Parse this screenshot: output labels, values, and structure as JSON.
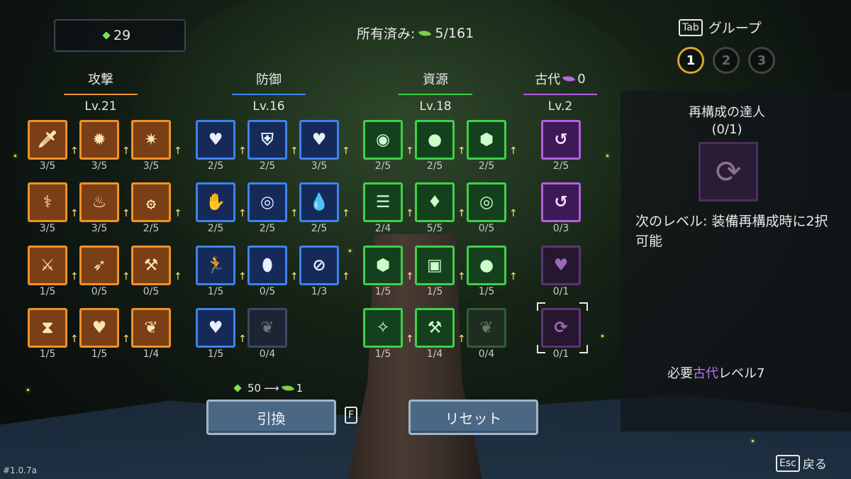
{
  "currency": {
    "amount": "29"
  },
  "owned": {
    "label": "所有済み:",
    "value": "5/161"
  },
  "groups": {
    "key": "Tab",
    "label": "グループ",
    "items": [
      "1",
      "2",
      "3"
    ],
    "active": 0
  },
  "columns": [
    {
      "title": "攻撃",
      "level": "Lv.21",
      "color": "#f0922a"
    },
    {
      "title": "防御",
      "level": "Lv.16",
      "color": "#3f83ec"
    },
    {
      "title": "資源",
      "level": "Lv.18",
      "color": "#3fd04a"
    },
    {
      "title": "古代",
      "badge": "0",
      "level": "Lv.2",
      "color": "#b35fe0"
    }
  ],
  "skills": {
    "attack": [
      {
        "icon": "sword-icon",
        "glyph": "🗡",
        "count": "3/5"
      },
      {
        "icon": "explosion-icon",
        "glyph": "✹",
        "count": "3/5"
      },
      {
        "icon": "burst-icon",
        "glyph": "✷",
        "count": "3/5"
      },
      {
        "icon": "staff-icon",
        "glyph": "⚕",
        "count": "3/5"
      },
      {
        "icon": "flame-icon",
        "glyph": "♨",
        "count": "3/5"
      },
      {
        "icon": "fire-ring-icon",
        "glyph": "۞",
        "count": "2/5"
      },
      {
        "icon": "slash-icon",
        "glyph": "⚔",
        "count": "1/5"
      },
      {
        "icon": "dash-icon",
        "glyph": "➶",
        "count": "0/5"
      },
      {
        "icon": "claw-icon",
        "glyph": "⚒",
        "count": "0/5"
      },
      {
        "icon": "hourglass-icon",
        "glyph": "⧗",
        "count": "1/5"
      },
      {
        "icon": "broken-heart-icon",
        "glyph": "♥",
        "count": "1/5"
      },
      {
        "icon": "leaf-icon",
        "glyph": "❦",
        "count": "1/4"
      }
    ],
    "defense": [
      {
        "icon": "hp-heart-icon",
        "glyph": "♥",
        "count": "2/5"
      },
      {
        "icon": "shield-icon",
        "glyph": "⛨",
        "count": "2/5"
      },
      {
        "icon": "heal-heart-icon",
        "glyph": "♥",
        "count": "3/5"
      },
      {
        "icon": "hand-icon",
        "glyph": "✋",
        "count": "2/5"
      },
      {
        "icon": "target-icon",
        "glyph": "◎",
        "count": "2/5"
      },
      {
        "icon": "droplet-icon",
        "glyph": "💧",
        "count": "2/5"
      },
      {
        "icon": "dodge-icon",
        "glyph": "🏃",
        "count": "1/5"
      },
      {
        "icon": "egg-icon",
        "glyph": "⬮",
        "count": "0/5"
      },
      {
        "icon": "ban-icon",
        "glyph": "⊘",
        "count": "1/3"
      },
      {
        "icon": "heart-10-icon",
        "glyph": "♥",
        "count": "1/5"
      },
      {
        "icon": "leaf-icon",
        "glyph": "❦",
        "count": "0/4"
      }
    ],
    "resource": [
      {
        "icon": "coin-icon",
        "glyph": "◉",
        "count": "2/5"
      },
      {
        "icon": "orb-icon",
        "glyph": "●",
        "count": "2/5"
      },
      {
        "icon": "crystal-icon",
        "glyph": "⬢",
        "count": "2/5"
      },
      {
        "icon": "coin-stack-icon",
        "glyph": "☰",
        "count": "2/4"
      },
      {
        "icon": "drop-icon",
        "glyph": "♦",
        "count": "5/5"
      },
      {
        "icon": "coin-10-icon",
        "glyph": "◎",
        "count": "0/5"
      },
      {
        "icon": "crystal-10-icon",
        "glyph": "⬢",
        "count": "1/5"
      },
      {
        "icon": "chest-icon",
        "glyph": "▣",
        "count": "1/5"
      },
      {
        "icon": "slime-icon",
        "glyph": "●",
        "count": "1/5"
      },
      {
        "icon": "fairy-icon",
        "glyph": "✧",
        "count": "1/5"
      },
      {
        "icon": "anvil-icon",
        "glyph": "⚒",
        "count": "1/4"
      },
      {
        "icon": "leaf-icon",
        "glyph": "❦",
        "count": "0/4"
      }
    ],
    "ancient": [
      {
        "icon": "swirl-icon",
        "glyph": "↺",
        "count": "2/5"
      },
      {
        "icon": "sparkle-swirl-icon",
        "glyph": "↺",
        "count": "0/3"
      },
      {
        "icon": "winged-heart-icon",
        "glyph": "♥",
        "count": "0/1"
      },
      {
        "icon": "hammer-cycle-icon",
        "glyph": "⟳",
        "count": "0/1"
      }
    ]
  },
  "detail": {
    "title": "再構成の達人",
    "progress": "(0/1)",
    "icon": "hammer-cycle-icon",
    "glyph": "⟳",
    "description": "次のレベル: 装備再構成時に2択可能",
    "requirement_prefix": "必要",
    "requirement_accent": "古代",
    "requirement_suffix": "レベル7"
  },
  "exchange": {
    "from": "50",
    "to": "1",
    "button": "引換",
    "key": "F"
  },
  "reset": {
    "button": "リセット"
  },
  "version": "#1.0.7a",
  "back": {
    "key": "Esc",
    "label": "戻る"
  }
}
